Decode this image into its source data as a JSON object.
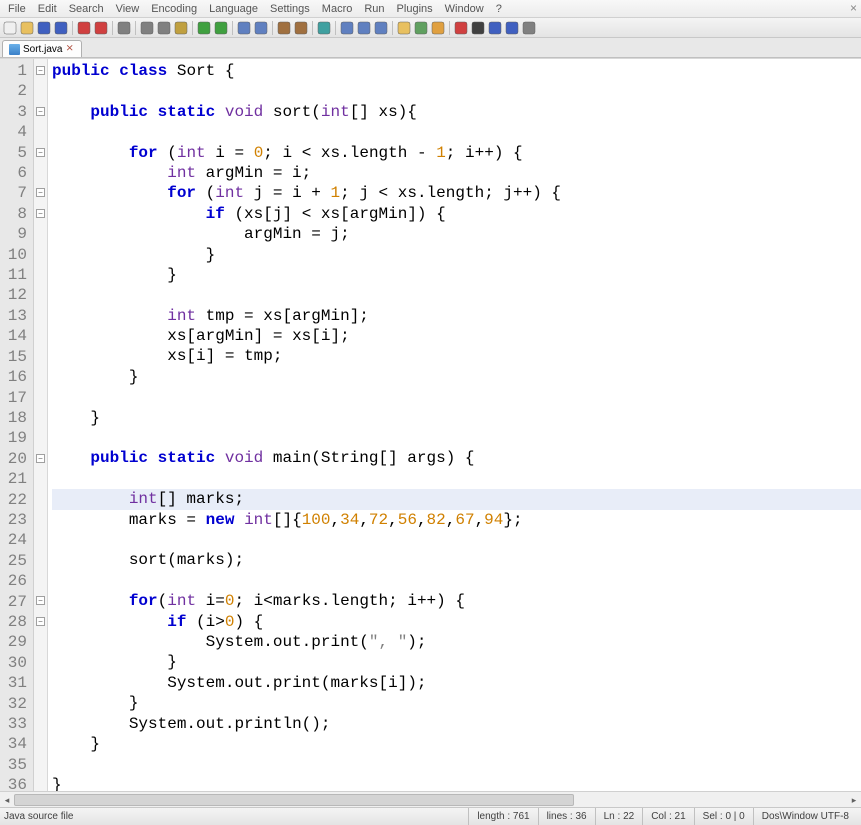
{
  "menu": [
    "File",
    "Edit",
    "Search",
    "View",
    "Encoding",
    "Language",
    "Settings",
    "Macro",
    "Run",
    "Plugins",
    "Window",
    "?"
  ],
  "tab": {
    "name": "Sort.java"
  },
  "status": {
    "filetype": "Java source file",
    "length": "length : 761",
    "lines": "lines : 36",
    "ln": "Ln : 22",
    "col": "Col : 21",
    "sel": "Sel : 0 | 0",
    "eol": "Dos\\Window UTF-8"
  },
  "highlight_line": 22,
  "fold_markers": [
    1,
    3,
    5,
    7,
    8,
    20,
    27,
    28
  ],
  "code": [
    {
      "n": 1,
      "t": [
        [
          "kw",
          "public"
        ],
        [
          "",
          ""
        ],
        [
          "id",
          " "
        ],
        [
          "kw",
          "class"
        ],
        [
          "id",
          " Sort "
        ],
        [
          "op",
          "{"
        ]
      ]
    },
    {
      "n": 2,
      "t": [
        [
          "",
          ""
        ]
      ]
    },
    {
      "n": 3,
      "t": [
        [
          "id",
          "    "
        ],
        [
          "kw",
          "public"
        ],
        [
          "id",
          " "
        ],
        [
          "kw",
          "static"
        ],
        [
          "id",
          " "
        ],
        [
          "type",
          "void"
        ],
        [
          "id",
          " sort"
        ],
        [
          "op",
          "("
        ],
        [
          "type",
          "int"
        ],
        [
          "op",
          "[]"
        ],
        [
          "id",
          " xs"
        ],
        [
          "op",
          "){"
        ]
      ]
    },
    {
      "n": 4,
      "t": [
        [
          "",
          ""
        ]
      ]
    },
    {
      "n": 5,
      "t": [
        [
          "id",
          "        "
        ],
        [
          "kw",
          "for"
        ],
        [
          "id",
          " "
        ],
        [
          "op",
          "("
        ],
        [
          "type",
          "int"
        ],
        [
          "id",
          " i "
        ],
        [
          "op",
          "="
        ],
        [
          "id",
          " "
        ],
        [
          "num",
          "0"
        ],
        [
          "op",
          ";"
        ],
        [
          "id",
          " i "
        ],
        [
          "op",
          "<"
        ],
        [
          "id",
          " xs"
        ],
        [
          "op",
          "."
        ],
        [
          "id",
          "length "
        ],
        [
          "op",
          "-"
        ],
        [
          "id",
          " "
        ],
        [
          "num",
          "1"
        ],
        [
          "op",
          ";"
        ],
        [
          "id",
          " i"
        ],
        [
          "op",
          "++) {"
        ]
      ]
    },
    {
      "n": 6,
      "t": [
        [
          "id",
          "            "
        ],
        [
          "type",
          "int"
        ],
        [
          "id",
          " argMin "
        ],
        [
          "op",
          "="
        ],
        [
          "id",
          " i"
        ],
        [
          "op",
          ";"
        ]
      ]
    },
    {
      "n": 7,
      "t": [
        [
          "id",
          "            "
        ],
        [
          "kw",
          "for"
        ],
        [
          "id",
          " "
        ],
        [
          "op",
          "("
        ],
        [
          "type",
          "int"
        ],
        [
          "id",
          " j "
        ],
        [
          "op",
          "="
        ],
        [
          "id",
          " i "
        ],
        [
          "op",
          "+"
        ],
        [
          "id",
          " "
        ],
        [
          "num",
          "1"
        ],
        [
          "op",
          ";"
        ],
        [
          "id",
          " j "
        ],
        [
          "op",
          "<"
        ],
        [
          "id",
          " xs"
        ],
        [
          "op",
          "."
        ],
        [
          "id",
          "length"
        ],
        [
          "op",
          ";"
        ],
        [
          "id",
          " j"
        ],
        [
          "op",
          "++) {"
        ]
      ]
    },
    {
      "n": 8,
      "t": [
        [
          "id",
          "                "
        ],
        [
          "kw",
          "if"
        ],
        [
          "id",
          " "
        ],
        [
          "op",
          "("
        ],
        [
          "id",
          "xs"
        ],
        [
          "op",
          "["
        ],
        [
          "id",
          "j"
        ],
        [
          "op",
          "]"
        ],
        [
          "id",
          " "
        ],
        [
          "op",
          "<"
        ],
        [
          "id",
          " xs"
        ],
        [
          "op",
          "["
        ],
        [
          "id",
          "argMin"
        ],
        [
          "op",
          "]) {"
        ]
      ]
    },
    {
      "n": 9,
      "t": [
        [
          "id",
          "                    argMin "
        ],
        [
          "op",
          "="
        ],
        [
          "id",
          " j"
        ],
        [
          "op",
          ";"
        ]
      ]
    },
    {
      "n": 10,
      "t": [
        [
          "id",
          "                "
        ],
        [
          "op",
          "}"
        ]
      ]
    },
    {
      "n": 11,
      "t": [
        [
          "id",
          "            "
        ],
        [
          "op",
          "}"
        ]
      ]
    },
    {
      "n": 12,
      "t": [
        [
          "",
          ""
        ]
      ]
    },
    {
      "n": 13,
      "t": [
        [
          "id",
          "            "
        ],
        [
          "type",
          "int"
        ],
        [
          "id",
          " tmp "
        ],
        [
          "op",
          "="
        ],
        [
          "id",
          " xs"
        ],
        [
          "op",
          "["
        ],
        [
          "id",
          "argMin"
        ],
        [
          "op",
          "];"
        ]
      ]
    },
    {
      "n": 14,
      "t": [
        [
          "id",
          "            xs"
        ],
        [
          "op",
          "["
        ],
        [
          "id",
          "argMin"
        ],
        [
          "op",
          "]"
        ],
        [
          "id",
          " "
        ],
        [
          "op",
          "="
        ],
        [
          "id",
          " xs"
        ],
        [
          "op",
          "["
        ],
        [
          "id",
          "i"
        ],
        [
          "op",
          "];"
        ]
      ]
    },
    {
      "n": 15,
      "t": [
        [
          "id",
          "            xs"
        ],
        [
          "op",
          "["
        ],
        [
          "id",
          "i"
        ],
        [
          "op",
          "]"
        ],
        [
          "id",
          " "
        ],
        [
          "op",
          "="
        ],
        [
          "id",
          " tmp"
        ],
        [
          "op",
          ";"
        ]
      ]
    },
    {
      "n": 16,
      "t": [
        [
          "id",
          "        "
        ],
        [
          "op",
          "}"
        ]
      ]
    },
    {
      "n": 17,
      "t": [
        [
          "",
          ""
        ]
      ]
    },
    {
      "n": 18,
      "t": [
        [
          "id",
          "    "
        ],
        [
          "op",
          "}"
        ]
      ]
    },
    {
      "n": 19,
      "t": [
        [
          "",
          ""
        ]
      ]
    },
    {
      "n": 20,
      "t": [
        [
          "id",
          "    "
        ],
        [
          "kw",
          "public"
        ],
        [
          "id",
          " "
        ],
        [
          "kw",
          "static"
        ],
        [
          "id",
          " "
        ],
        [
          "type",
          "void"
        ],
        [
          "id",
          " main"
        ],
        [
          "op",
          "("
        ],
        [
          "id",
          "String"
        ],
        [
          "op",
          "[]"
        ],
        [
          "id",
          " args"
        ],
        [
          "op",
          ") {"
        ]
      ]
    },
    {
      "n": 21,
      "t": [
        [
          "",
          ""
        ]
      ]
    },
    {
      "n": 22,
      "t": [
        [
          "id",
          "        "
        ],
        [
          "type",
          "int"
        ],
        [
          "op",
          "[]"
        ],
        [
          "id",
          " marks"
        ],
        [
          "op",
          ";"
        ]
      ]
    },
    {
      "n": 23,
      "t": [
        [
          "id",
          "        marks "
        ],
        [
          "op",
          "="
        ],
        [
          "id",
          " "
        ],
        [
          "kw",
          "new"
        ],
        [
          "id",
          " "
        ],
        [
          "type",
          "int"
        ],
        [
          "op",
          "[]{"
        ],
        [
          "num",
          "100"
        ],
        [
          "op",
          ","
        ],
        [
          "num",
          "34"
        ],
        [
          "op",
          ","
        ],
        [
          "num",
          "72"
        ],
        [
          "op",
          ","
        ],
        [
          "num",
          "56"
        ],
        [
          "op",
          ","
        ],
        [
          "num",
          "82"
        ],
        [
          "op",
          ","
        ],
        [
          "num",
          "67"
        ],
        [
          "op",
          ","
        ],
        [
          "num",
          "94"
        ],
        [
          "op",
          "};"
        ]
      ]
    },
    {
      "n": 24,
      "t": [
        [
          "",
          ""
        ]
      ]
    },
    {
      "n": 25,
      "t": [
        [
          "id",
          "        sort"
        ],
        [
          "op",
          "("
        ],
        [
          "id",
          "marks"
        ],
        [
          "op",
          ");"
        ]
      ]
    },
    {
      "n": 26,
      "t": [
        [
          "",
          ""
        ]
      ]
    },
    {
      "n": 27,
      "t": [
        [
          "id",
          "        "
        ],
        [
          "kw",
          "for"
        ],
        [
          "op",
          "("
        ],
        [
          "type",
          "int"
        ],
        [
          "id",
          " i"
        ],
        [
          "op",
          "="
        ],
        [
          "num",
          "0"
        ],
        [
          "op",
          ";"
        ],
        [
          "id",
          " i"
        ],
        [
          "op",
          "<"
        ],
        [
          "id",
          "marks"
        ],
        [
          "op",
          "."
        ],
        [
          "id",
          "length"
        ],
        [
          "op",
          ";"
        ],
        [
          "id",
          " i"
        ],
        [
          "op",
          "++) {"
        ]
      ]
    },
    {
      "n": 28,
      "t": [
        [
          "id",
          "            "
        ],
        [
          "kw",
          "if"
        ],
        [
          "id",
          " "
        ],
        [
          "op",
          "("
        ],
        [
          "id",
          "i"
        ],
        [
          "op",
          ">"
        ],
        [
          "num",
          "0"
        ],
        [
          "op",
          ") {"
        ]
      ]
    },
    {
      "n": 29,
      "t": [
        [
          "id",
          "                System"
        ],
        [
          "op",
          "."
        ],
        [
          "id",
          "out"
        ],
        [
          "op",
          "."
        ],
        [
          "id",
          "print"
        ],
        [
          "op",
          "("
        ],
        [
          "str",
          "\", \""
        ],
        [
          "op",
          ");"
        ]
      ]
    },
    {
      "n": 30,
      "t": [
        [
          "id",
          "            "
        ],
        [
          "op",
          "}"
        ]
      ]
    },
    {
      "n": 31,
      "t": [
        [
          "id",
          "            System"
        ],
        [
          "op",
          "."
        ],
        [
          "id",
          "out"
        ],
        [
          "op",
          "."
        ],
        [
          "id",
          "print"
        ],
        [
          "op",
          "("
        ],
        [
          "id",
          "marks"
        ],
        [
          "op",
          "["
        ],
        [
          "id",
          "i"
        ],
        [
          "op",
          "]);"
        ]
      ]
    },
    {
      "n": 32,
      "t": [
        [
          "id",
          "        "
        ],
        [
          "op",
          "}"
        ]
      ]
    },
    {
      "n": 33,
      "t": [
        [
          "id",
          "        System"
        ],
        [
          "op",
          "."
        ],
        [
          "id",
          "out"
        ],
        [
          "op",
          "."
        ],
        [
          "id",
          "println"
        ],
        [
          "op",
          "();"
        ]
      ]
    },
    {
      "n": 34,
      "t": [
        [
          "id",
          "    "
        ],
        [
          "op",
          "}"
        ]
      ]
    },
    {
      "n": 35,
      "t": [
        [
          "",
          ""
        ]
      ]
    },
    {
      "n": 36,
      "t": [
        [
          "op",
          "}"
        ]
      ]
    }
  ],
  "toolbar_icons": [
    "new-file",
    "open-file",
    "save",
    "save-all",
    "sep",
    "close",
    "close-all",
    "sep",
    "print",
    "sep",
    "cut",
    "copy",
    "paste",
    "sep",
    "undo",
    "redo",
    "sep",
    "find",
    "replace",
    "sep",
    "zoom-in",
    "zoom-out",
    "sep",
    "sync",
    "sep",
    "wrap",
    "show-all",
    "indent-guide",
    "sep",
    "folder",
    "function-list",
    "doc-map",
    "sep",
    "record",
    "stop",
    "play",
    "play-multi",
    "save-macro"
  ]
}
